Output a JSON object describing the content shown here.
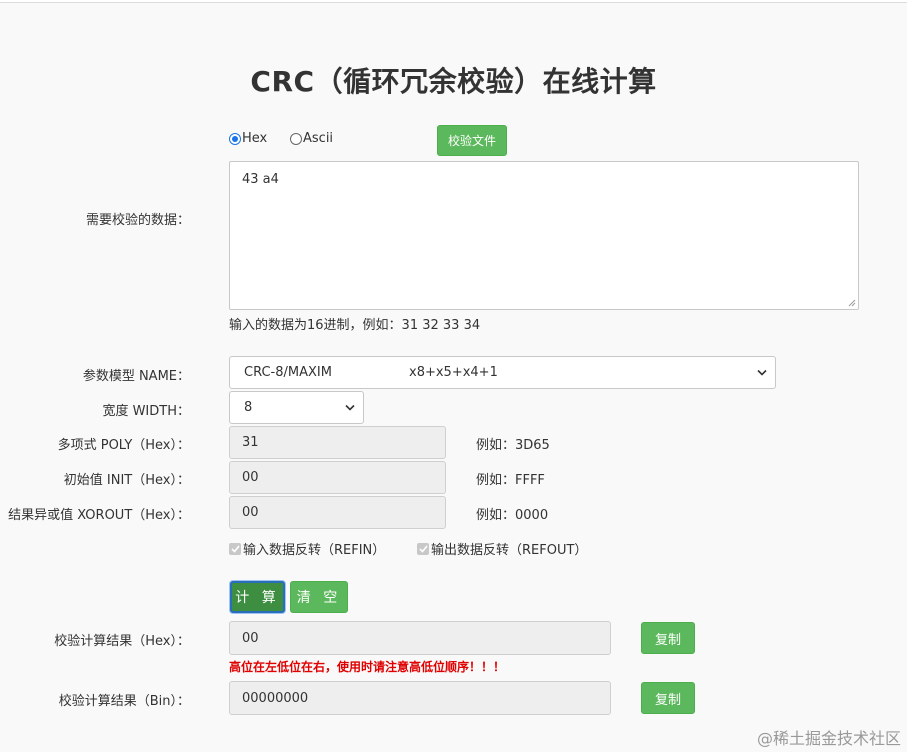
{
  "page": {
    "title": "CRC（循环冗余校验）在线计算"
  },
  "input_mode": {
    "hex_label": "Hex",
    "ascii_label": "Ascii",
    "selected": "Hex",
    "verify_file_label": "校验文件"
  },
  "data_input": {
    "label": "需要校验的数据：",
    "value": "43 a4",
    "hint": "输入的数据为16进制，例如：31 32 33 34"
  },
  "params": {
    "model_label": "参数模型 NAME：",
    "model_name": "CRC-8/MAXIM",
    "model_poly": "x8+x5+x4+1",
    "width_label": "宽度 WIDTH：",
    "width_value": "8",
    "poly_label": "多项式 POLY（Hex）：",
    "poly_value": "31",
    "poly_example": "例如：3D65",
    "init_label": "初始值 INIT（Hex）：",
    "init_value": "00",
    "init_example": "例如：FFFF",
    "xorout_label": "结果异或值 XOROUT（Hex）：",
    "xorout_value": "00",
    "xorout_example": "例如：0000",
    "refin_label": "输入数据反转（REFIN）",
    "refin_checked": true,
    "refout_label": "输出数据反转（REFOUT）",
    "refout_checked": true
  },
  "actions": {
    "calc_label": "计 算",
    "clear_label": "清 空"
  },
  "results": {
    "hex_label": "校验计算结果（Hex）：",
    "hex_value": "00",
    "copy_label": "复制",
    "warning": "高位在左低位在右，使用时请注意高低位顺序！！！",
    "bin_label": "校验计算结果（Bin）：",
    "bin_value": "00000000"
  },
  "watermark": {
    "text": "@稀土掘金技术社区"
  },
  "colors": {
    "accent_green": "#5cb85c",
    "warning_red": "#e00000",
    "radio_blue": "#1a73e8"
  }
}
